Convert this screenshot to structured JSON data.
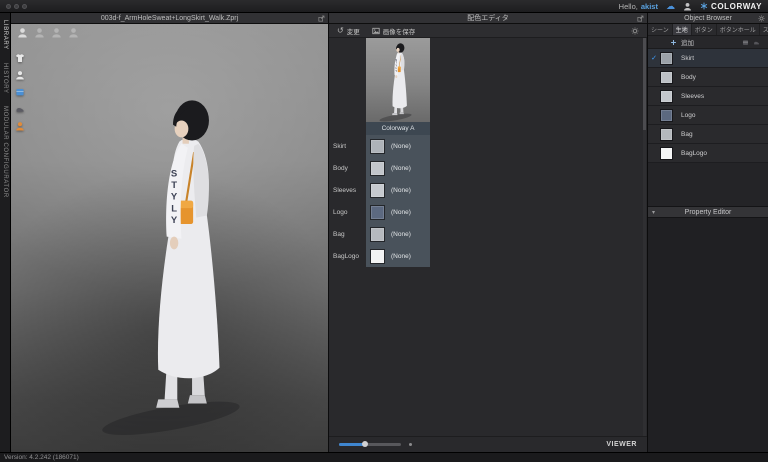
{
  "topbar": {
    "greeting_prefix": "Hello,",
    "username": "akist",
    "brand": "COLORWAY"
  },
  "left_rail": {
    "tabs": [
      {
        "label": "LIBRARY"
      },
      {
        "label": "HISTORY"
      },
      {
        "label": "MODULAR CONFIGURATOR"
      }
    ]
  },
  "viewport": {
    "title": "003d-f_ArmHoleSweat+LongSkirt_Walk.Zprj",
    "garment_letters": [
      "S",
      "T",
      "Y",
      "L",
      "Y"
    ]
  },
  "colorway_editor": {
    "title": "配色エディタ",
    "change_button": "変更",
    "save_image_button": "画像を保存",
    "colorway_name": "Colorway A",
    "rows": [
      {
        "label": "Skirt",
        "value": "(None)",
        "swatch": "#aeb3b9"
      },
      {
        "label": "Body",
        "value": "(None)",
        "swatch": "#c2c6cb"
      },
      {
        "label": "Sleeves",
        "value": "(None)",
        "swatch": "#c6cacf"
      },
      {
        "label": "Logo",
        "value": "(None)",
        "swatch": "#5c6980"
      },
      {
        "label": "Bag",
        "value": "(None)",
        "swatch": "#b6babf"
      },
      {
        "label": "BagLogo",
        "value": "(None)",
        "swatch": "#f2f3f4"
      }
    ],
    "viewer_label": "VIEWER"
  },
  "object_browser": {
    "title": "Object Browser",
    "tabs": [
      {
        "label": "シーン"
      },
      {
        "label": "生地"
      },
      {
        "label": "ボタン"
      },
      {
        "label": "ボタンホール"
      },
      {
        "label": "ステ..."
      }
    ],
    "add_label": "追加",
    "items": [
      {
        "label": "Skirt",
        "checked": "✓",
        "swatch": "#9ba1a8"
      },
      {
        "label": "Body",
        "checked": "",
        "swatch": "#bdc1c6"
      },
      {
        "label": "Sleeves",
        "checked": "",
        "swatch": "#c3c7cc"
      },
      {
        "label": "Logo",
        "checked": "",
        "swatch": "#5c6980"
      },
      {
        "label": "Bag",
        "checked": "",
        "swatch": "#b4b8bd"
      },
      {
        "label": "BagLogo",
        "checked": "",
        "swatch": "#f4f5f6"
      }
    ]
  },
  "property_editor": {
    "title": "Property Editor"
  },
  "statusbar": {
    "version": "Version: 4.2.242 (186071)"
  }
}
